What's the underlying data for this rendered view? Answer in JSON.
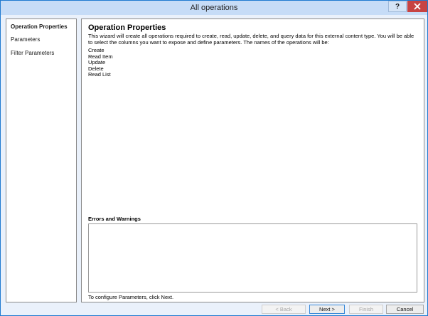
{
  "window": {
    "title": "All operations",
    "help_label": "?"
  },
  "nav": {
    "items": [
      {
        "label": "Operation Properties",
        "active": true
      },
      {
        "label": "Parameters",
        "active": false
      },
      {
        "label": "Filter Parameters",
        "active": false
      }
    ]
  },
  "content": {
    "heading": "Operation Properties",
    "description": "This wizard will create all operations required to create, read, update, delete, and query data for this external content type. You will be able to select the columns you want to expose and define parameters. The names of the operations will be:",
    "operations": [
      "Create",
      "Read Item",
      "Update",
      "Delete",
      "Read List"
    ],
    "errors_label": "Errors and Warnings",
    "hint": "To configure Parameters, click Next."
  },
  "footer": {
    "back_label": "< Back",
    "next_label": "Next >",
    "finish_label": "Finish",
    "cancel_label": "Cancel"
  },
  "colors": {
    "titlebar": "#c6dcf7",
    "close": "#c74342",
    "window_bg": "#eaf1fb"
  }
}
